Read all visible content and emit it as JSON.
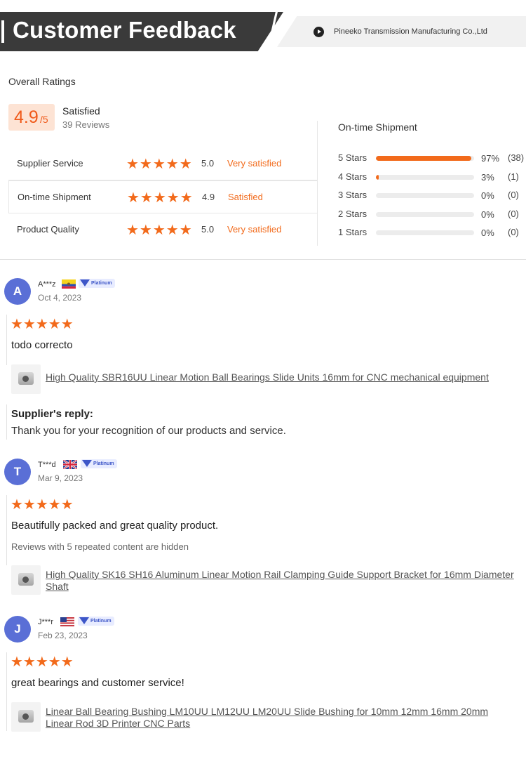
{
  "header": {
    "title": "Customer Feedback",
    "company": "Pineeko Transmission Manufacturing Co.,Ltd"
  },
  "overall": {
    "label": "Overall Ratings",
    "score": "4.9",
    "score_suffix": "/5",
    "satisfaction": "Satisfied",
    "reviews": "39 Reviews",
    "rows": [
      {
        "label": "Supplier Service",
        "stars": "★★★★★",
        "score": "5.0",
        "text": "Very satisfied"
      },
      {
        "label": "On-time Shipment",
        "stars": "★★★★★",
        "score": "4.9",
        "text": "Satisfied"
      },
      {
        "label": "Product Quality",
        "stars": "★★★★★",
        "score": "5.0",
        "text": "Very satisfied"
      }
    ]
  },
  "shipment": {
    "title": "On-time Shipment",
    "bars": [
      {
        "label": "5 Stars",
        "percent": "97%",
        "count": "(38)",
        "fill": 0.97
      },
      {
        "label": "4 Stars",
        "percent": "3%",
        "count": "(1)",
        "fill": 0.03
      },
      {
        "label": "3 Stars",
        "percent": "0%",
        "count": "(0)",
        "fill": 0
      },
      {
        "label": "2 Stars",
        "percent": "0%",
        "count": "(0)",
        "fill": 0
      },
      {
        "label": "1 Stars",
        "percent": "0%",
        "count": "(0)",
        "fill": 0
      }
    ]
  },
  "reviews": [
    {
      "initial": "A",
      "name": "A***z",
      "badge": "Platinum",
      "flag_icon": "ecuador-flag-icon",
      "date": "Oct 4, 2023",
      "stars": "★★★★★",
      "text": "todo correcto",
      "product": "High Quality SBR16UU Linear Motion Ball Bearings Slide Units 16mm for CNC mechanical equipment",
      "reply_title": "Supplier's reply:",
      "reply_text": "Thank you for your recognition of our products and service."
    },
    {
      "initial": "T",
      "name": "T***d",
      "badge": "Platinum",
      "flag_icon": "uk-flag-icon",
      "date": "Mar 9, 2023",
      "stars": "★★★★★",
      "text": "Beautifully packed and great quality product.",
      "hidden_note": "Reviews with 5 repeated content are hidden",
      "product": "High Quality SK16 SH16 Aluminum Linear Motion Rail Clamping Guide Support Bracket for 16mm Diameter Shaft"
    },
    {
      "initial": "J",
      "name": "J***r",
      "badge": "Platinum",
      "flag_icon": "us-flag-icon",
      "date": "Feb 23, 2023",
      "stars": "★★★★★",
      "text": "great bearings and customer service!",
      "product": "Linear Ball Bearing Bushing LM10UU LM12UU LM20UU Slide Bushing for 10mm 12mm 16mm 20mm Linear Rod 3D Printer CNC Parts"
    }
  ],
  "colors": {
    "accent": "#f26a1b",
    "avatar": "#5a6fd6",
    "banner": "#3a3a3a"
  }
}
